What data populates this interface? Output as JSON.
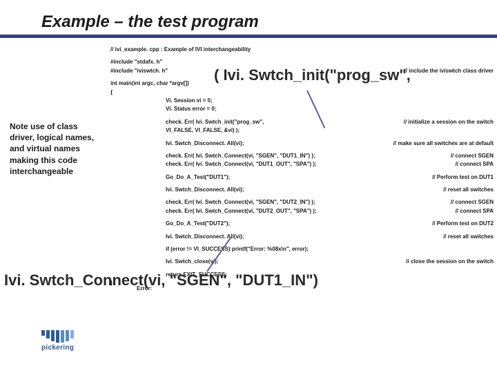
{
  "title": "Example – the test program",
  "note": "Note use of class driver, logical names, and virtual names making this code interchangeable",
  "callout1": "( Ivi. Swtch_init(\"prog_sw\",",
  "callout2": "Ivi. Swtch_Connect(vi, \"SGEN\", \"DUT1_IN\")",
  "errorLabel": "Error:",
  "logoText": "pickering",
  "code": {
    "l1": "// ivi_example. cpp : Example of IVI interchangeability",
    "l2": "#include \"stdafx. h\"",
    "l3": "#include \"iviswtch. h\"",
    "l3c": "// include the iviswtch class driver",
    "l4": "int main(int argc, char *argv[])",
    "l5": "{",
    "l6": "Vi. Session vi = 0;",
    "l7": "Vi. Status error = 0;",
    "l8": "check. Err( Ivi. Swtch_init(\"prog_sw\",",
    "l8c": "// initialize a session on the switch",
    "l9": "                       VI_FALSE, VI_FALSE, &vi) );",
    "l10": "Ivi. Swtch_Disconnect. All(vi);",
    "l10c": "// make sure all switches are at default",
    "l11": "check. Err(  Ivi. Swtch_Connect(vi, \"SGEN\", \"DUT1_IN\") );",
    "l11c": "// connect SGEN",
    "l12": "check. Err(  Ivi. Swtch_Connect(vi, \"DUT1_OUT\", \"SPA\") );",
    "l12c": "// connect SPA",
    "l13": "Go_Do_A_Test(\"DUT1\");",
    "l13c": "// Perform test on DUT1",
    "l14": "Ivi. Swtch_Disconnect. All(vi);",
    "l14c": "// reset all switches",
    "l15": "check. Err(  Ivi. Swtch_Connect(vi, \"SGEN\", \"DUT2_IN\") );",
    "l15c": "// connect SGEN",
    "l16": "check. Err(  Ivi. Swtch_Connect(vi, \"DUT2_OUT\", \"SPA\") );",
    "l16c": "// connect SPA",
    "l17": "Go_Do_A_Test(\"DUT2\");",
    "l17c": "// Perform test on DUT2",
    "l18": "Ivi. Swtch_Disconnect. All(vi);",
    "l18c": "// reset all switches",
    "l19": "if (error != VI_SUCCESS) printf(\"Error: %08x\\n\", error);",
    "l20": "Ivi. Swtch_close(vi);",
    "l20c": "// close the session on the switch",
    "l21": "return EXIT_SUCCESS;",
    "l22": "}"
  }
}
